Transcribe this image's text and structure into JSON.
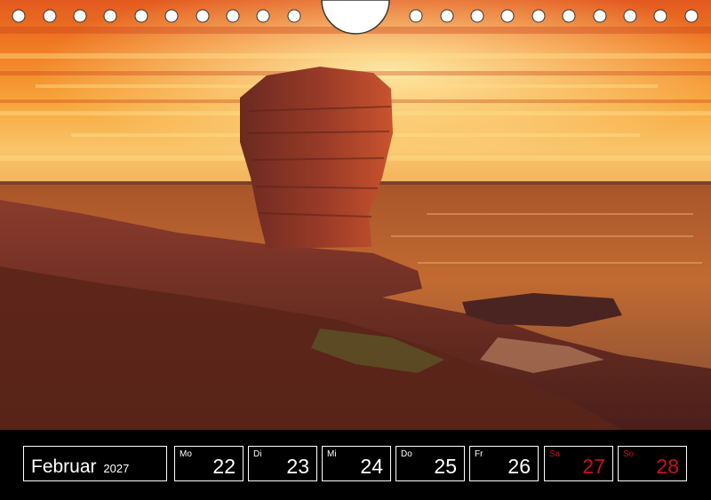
{
  "calendar": {
    "month": "Februar",
    "year": "2027",
    "days": [
      {
        "abbr": "Mo",
        "num": "22",
        "weekend": false
      },
      {
        "abbr": "Di",
        "num": "23",
        "weekend": false
      },
      {
        "abbr": "Mi",
        "num": "24",
        "weekend": false
      },
      {
        "abbr": "Do",
        "num": "25",
        "weekend": false
      },
      {
        "abbr": "Fr",
        "num": "26",
        "weekend": false
      },
      {
        "abbr": "Sa",
        "num": "27",
        "weekend": true
      },
      {
        "abbr": "So",
        "num": "28",
        "weekend": true
      }
    ]
  },
  "colors": {
    "strip_background": "#000000",
    "weekend_text": "#c8101e",
    "weekday_text": "#ffffff"
  }
}
